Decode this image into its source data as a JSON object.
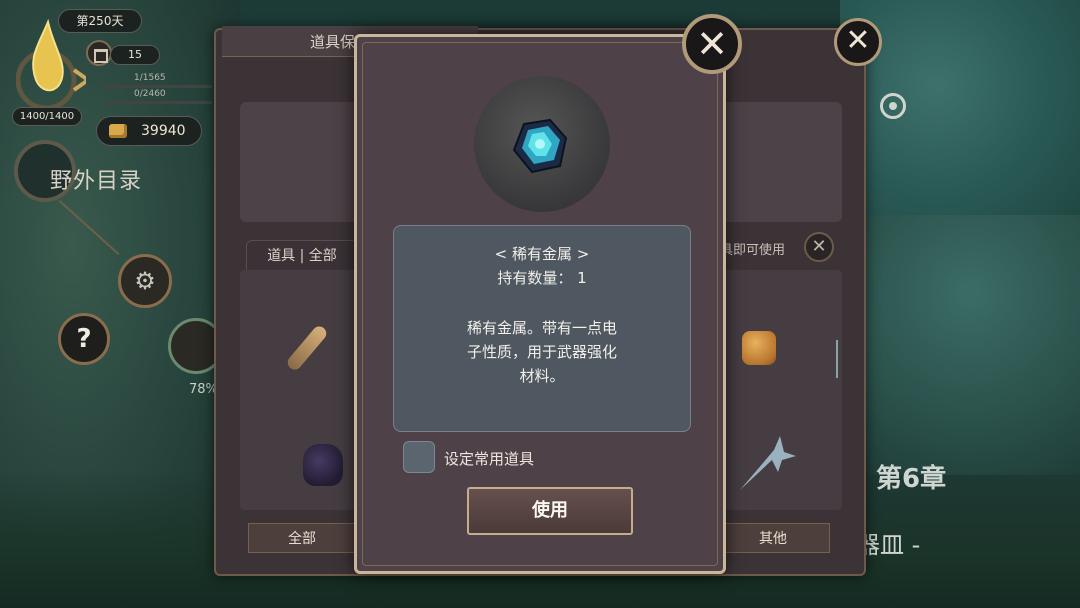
{
  "hud": {
    "day": "第250天",
    "calendar_count": "15",
    "stat1": "1/1565",
    "stat2": "0/2460",
    "hp": "1400/1400",
    "gold": "39940",
    "field_catalog": "野外目录",
    "help": "?",
    "progress_pct": "78%"
  },
  "map": {
    "chapter": "第6章",
    "chapter_sub": "神器皿 -"
  },
  "storage_panel": {
    "title": "道具保管箱",
    "tab_label": "道具 | 全部",
    "instant_use_label": "具即可使用",
    "close_symbol": "✕",
    "tabs": {
      "all": "全部",
      "other": "其他"
    }
  },
  "item_dialog": {
    "close_symbol": "✕",
    "name": "< 稀有金属 >",
    "count_label": "持有数量： 1",
    "description": "稀有金属。带有一点电子性质，用于武器强化材料。",
    "favorite_label": "设定常用道具",
    "favorite_checked": false,
    "use_button": "使用"
  },
  "colors": {
    "panel_border": "#c9b69b",
    "desc_bg": "#4f5861",
    "ore_cyan": "#39c6d6"
  }
}
